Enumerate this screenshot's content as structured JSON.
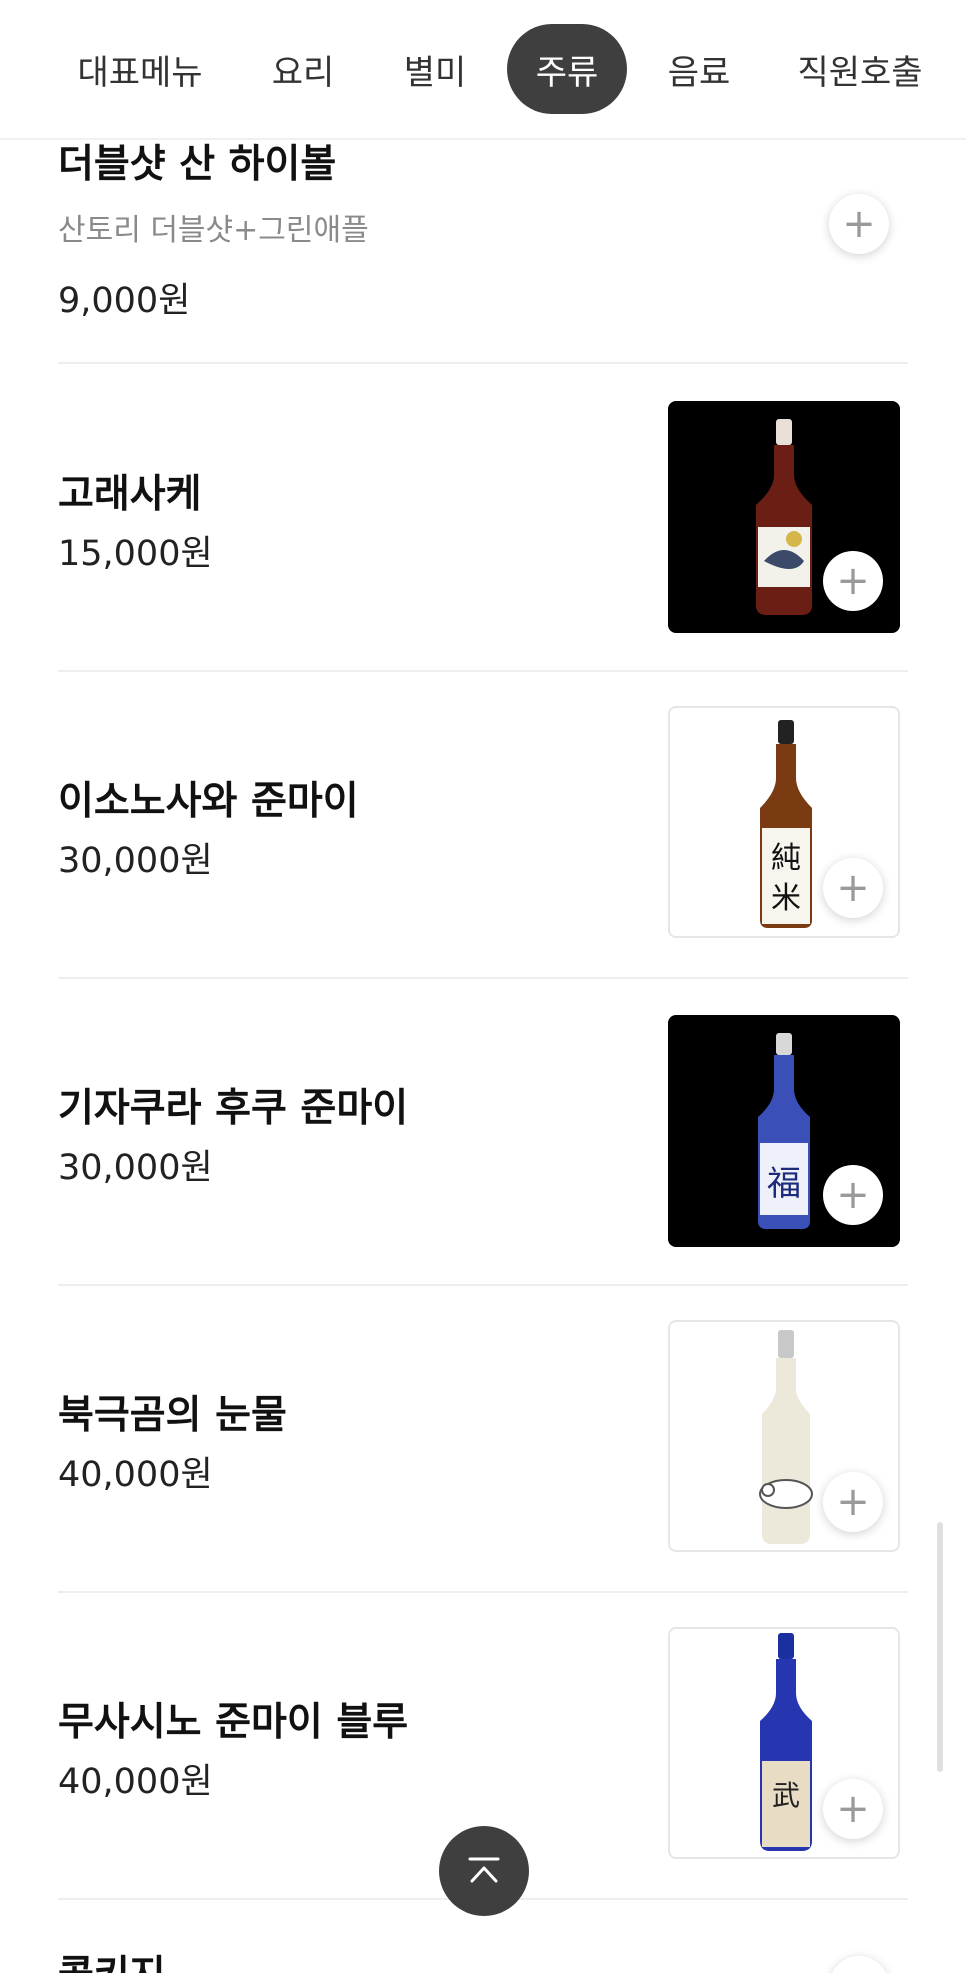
{
  "tabs": [
    {
      "label": "대표메뉴"
    },
    {
      "label": "요리"
    },
    {
      "label": "별미"
    },
    {
      "label": "주류",
      "active": true
    },
    {
      "label": "음료"
    },
    {
      "label": "직원호출"
    }
  ],
  "items": [
    {
      "name": "더블샷 산 하이볼",
      "desc": "산토리 더블샷+그린애플",
      "price": "9,000원"
    },
    {
      "name": "고래사케",
      "price": "15,000원"
    },
    {
      "name": "이소노사와 준마이",
      "price": "30,000원"
    },
    {
      "name": "기자쿠라 후쿠 준마이",
      "price": "30,000원"
    },
    {
      "name": "북극곰의 눈물",
      "price": "40,000원"
    },
    {
      "name": "무사시노 준마이 블루",
      "price": "40,000원"
    },
    {
      "name": "콜키지"
    }
  ],
  "icons": {
    "add": "+",
    "scroll_top": "chevron-up-icon"
  },
  "colors": {
    "active_tab_bg": "#3f3f3f",
    "scroll_top_bg": "#3f3f3f"
  }
}
